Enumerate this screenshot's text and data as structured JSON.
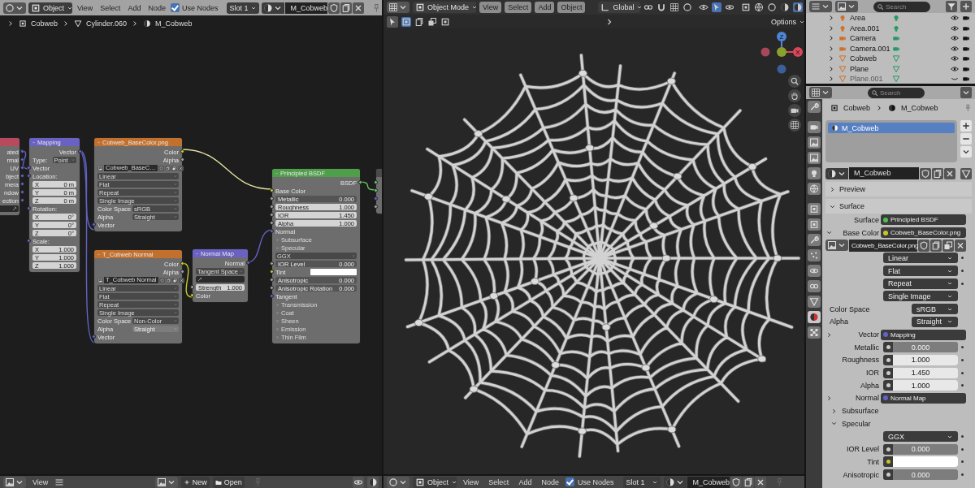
{
  "node_editor": {
    "header": {
      "mode": "Object",
      "menus": [
        "View",
        "Select",
        "Add",
        "Node"
      ],
      "use_nodes": {
        "label": "Use Nodes",
        "checked": true
      },
      "slot": "Slot 1",
      "material": "M_Cobweb"
    },
    "breadcrumbs": [
      "Cobweb",
      "Cylinder.060",
      "M_Cobweb"
    ],
    "nodes": [
      {
        "color": "#b84a5e",
        "rows": [
          {
            "kind": "output",
            "label": "ated",
            "socket": {
              "color": "#6363c7"
            }
          },
          {
            "kind": "output",
            "label": "rmal",
            "socket": {
              "color": "#6363c7"
            }
          },
          {
            "kind": "output",
            "label": "UV",
            "socket": {
              "color": "#6363c7"
            }
          },
          {
            "kind": "output",
            "label": "bject",
            "socket": {
              "color": "#6363c7"
            }
          },
          {
            "kind": "output",
            "label": "mera",
            "socket": {
              "color": "#6363c7"
            }
          },
          {
            "kind": "output",
            "label": "ndow",
            "socket": {
              "color": "#6363c7"
            }
          },
          {
            "kind": "output",
            "label": "ection",
            "socket": {
              "color": "#6363c7"
            }
          },
          {
            "kind": "uvmap"
          }
        ]
      },
      {
        "title": "Mapping",
        "color": "#6a62c2",
        "rows": [
          {
            "kind": "output",
            "label": "Vector",
            "socket": {
              "color": "#6363c7"
            }
          },
          {
            "kind": "dropdown",
            "label": "Type:",
            "value": "Point"
          },
          {
            "kind": "input",
            "label": "Vector",
            "socket": {
              "color": "#6363c7"
            }
          },
          {
            "kind": "input",
            "label": "Location:",
            "socket": {
              "color": "#6363c7"
            }
          },
          {
            "kind": "number",
            "label": "X",
            "value": "0 m"
          },
          {
            "kind": "number",
            "label": "Y",
            "value": "0 m"
          },
          {
            "kind": "number",
            "label": "Z",
            "value": "0 m"
          },
          {
            "kind": "input",
            "label": "Rotation:",
            "socket": {
              "color": "#6363c7"
            }
          },
          {
            "kind": "number",
            "label": "X",
            "value": "0°"
          },
          {
            "kind": "number",
            "label": "Y",
            "value": "0°"
          },
          {
            "kind": "number",
            "label": "Z",
            "value": "0°"
          },
          {
            "kind": "input",
            "label": "Scale:",
            "socket": {
              "color": "#6363c7"
            }
          },
          {
            "kind": "number",
            "label": "X",
            "value": "1.000"
          },
          {
            "kind": "number",
            "label": "Y",
            "value": "1.000"
          },
          {
            "kind": "number",
            "label": "Z",
            "value": "1.000"
          }
        ]
      },
      {
        "title": "Cobweb_BaseColor.png",
        "color": "#c2702e",
        "rows": [
          {
            "kind": "output",
            "label": "Color",
            "socket": {
              "color": "#c7c729"
            }
          },
          {
            "kind": "output",
            "label": "Alpha",
            "socket": {
              "color": "#a1a1a1"
            }
          },
          {
            "kind": "image",
            "value": "Cobweb_BaseC…"
          },
          {
            "kind": "dropdown",
            "value": "Linear"
          },
          {
            "kind": "dropdown",
            "value": "Flat"
          },
          {
            "kind": "dropdown",
            "value": "Repeat"
          },
          {
            "kind": "dropdown",
            "value": "Single Image"
          },
          {
            "kind": "dropdown",
            "label": "Color Space",
            "value": "sRGB"
          },
          {
            "kind": "dropdown",
            "label": "Alpha",
            "value": "Straight"
          },
          {
            "kind": "input",
            "label": "Vector",
            "socket": {
              "color": "#6363c7"
            }
          }
        ]
      },
      {
        "title": "T_Cobweb Normal",
        "color": "#c2702e",
        "rows": [
          {
            "kind": "output",
            "label": "Color",
            "socket": {
              "color": "#c7c729"
            }
          },
          {
            "kind": "output",
            "label": "Alpha",
            "socket": {
              "color": "#a1a1a1"
            }
          },
          {
            "kind": "image",
            "value": "T_Cobweb Normal"
          },
          {
            "kind": "dropdown",
            "value": "Linear"
          },
          {
            "kind": "dropdown",
            "value": "Flat"
          },
          {
            "kind": "dropdown",
            "value": "Repeat"
          },
          {
            "kind": "dropdown",
            "value": "Single Image"
          },
          {
            "kind": "dropdown",
            "label": "Color Space",
            "value": "Non-Color"
          },
          {
            "kind": "dropdown",
            "label": "Alpha",
            "value": "Straight",
            "disabled": true
          },
          {
            "kind": "input",
            "label": "Vector",
            "socket": {
              "color": "#6363c7"
            }
          }
        ]
      },
      {
        "title": "Normal Map",
        "color": "#6a62c2",
        "rows": [
          {
            "kind": "output",
            "label": "Normal",
            "socket": {
              "color": "#6363c7"
            }
          },
          {
            "kind": "dropdown",
            "value": "Tangent Space"
          },
          {
            "kind": "uvmap"
          },
          {
            "kind": "number",
            "label": "Strength",
            "value": "1.000",
            "socket": {
              "color": "#a1a1a1"
            }
          },
          {
            "kind": "input",
            "label": "Color",
            "socket": {
              "color": "#c7c729"
            }
          }
        ]
      },
      {
        "title": "Principled BSDF",
        "color": "#4e9e4a",
        "rows": [
          {
            "kind": "output",
            "label": "BSDF",
            "socket": {
              "color": "#63c763"
            }
          },
          {
            "kind": "input",
            "label": "Base Color",
            "socket": {
              "color": "#c7c729"
            }
          },
          {
            "kind": "slider",
            "label": "Metallic",
            "value": "0.000",
            "level": 0,
            "socket": {
              "color": "#a1a1a1"
            }
          },
          {
            "kind": "slider",
            "label": "Roughness",
            "value": "1.000",
            "level": 1,
            "socket": {
              "color": "#a1a1a1"
            }
          },
          {
            "kind": "number",
            "label": "IOR",
            "value": "1.450",
            "socket": {
              "color": "#a1a1a1"
            }
          },
          {
            "kind": "slider",
            "label": "Alpha",
            "value": "1.000",
            "level": 1,
            "socket": {
              "color": "#a1a1a1"
            }
          },
          {
            "kind": "input",
            "label": "Normal",
            "socket": {
              "color": "#6363c7"
            }
          },
          {
            "kind": "panel",
            "label": "Subsurface",
            "expanded": false
          },
          {
            "kind": "panel",
            "label": "Specular",
            "expanded": true
          },
          {
            "kind": "dropdown",
            "value": "GGX"
          },
          {
            "kind": "slider",
            "label": "IOR Level",
            "value": "0.000",
            "level": 0,
            "socket": {
              "color": "#a1a1a1"
            }
          },
          {
            "kind": "color",
            "label": "Tint",
            "color": "#ffffff",
            "socket": {
              "color": "#c7c729"
            }
          },
          {
            "kind": "slider",
            "label": "Anisotropic",
            "value": "0.000",
            "level": 0,
            "socket": {
              "color": "#a1a1a1"
            }
          },
          {
            "kind": "slider",
            "label": "Anisotropic Rotation",
            "value": "0.000",
            "level": 0,
            "socket": {
              "color": "#a1a1a1"
            }
          },
          {
            "kind": "input",
            "label": "Tangent",
            "socket": {
              "color": "#6363c7"
            }
          },
          {
            "kind": "panel",
            "label": "Transmission",
            "expanded": false
          },
          {
            "kind": "panel",
            "label": "Coat",
            "expanded": false
          },
          {
            "kind": "panel",
            "label": "Sheen",
            "expanded": false
          },
          {
            "kind": "panel",
            "label": "Emission",
            "expanded": false
          },
          {
            "kind": "panel",
            "label": "Thin Film",
            "expanded": false
          }
        ]
      },
      {
        "color": "#4a4a4a",
        "rows": [
          {
            "kind": "input",
            "socket": {
              "color": "#63c763"
            }
          },
          {
            "kind": "input",
            "socket": {
              "color": "#63c763"
            }
          },
          {
            "kind": "input",
            "socket": {
              "color": "#6363c7"
            }
          },
          {
            "kind": "input",
            "socket": {
              "color": "#a1a1a1"
            }
          }
        ]
      }
    ],
    "footer": {
      "view": "View",
      "new": "New",
      "open": "Open"
    }
  },
  "viewport": {
    "header": {
      "mode": "Object Mode",
      "menus": [
        "View",
        "Select",
        "Add",
        "Object"
      ],
      "orientation": "Global",
      "options": "Options"
    },
    "gizmo": {
      "z": "Z",
      "x": "X"
    }
  },
  "viewport_footer": {
    "mode": "Object",
    "menus": [
      "View",
      "Select",
      "Add",
      "Node"
    ],
    "use_nodes": {
      "label": "Use Nodes",
      "checked": true
    },
    "slot": "Slot 1",
    "material": "M_Cobweb"
  },
  "outliner": {
    "search": {
      "placeholder": "Search"
    },
    "items": [
      {
        "name": "Area",
        "kind": "light",
        "visible": true
      },
      {
        "name": "Area.001",
        "kind": "light",
        "visible": true
      },
      {
        "name": "Camera",
        "kind": "camera",
        "visible": true
      },
      {
        "name": "Camera.001",
        "kind": "camera",
        "visible": true
      },
      {
        "name": "Cobweb",
        "kind": "mesh",
        "visible": true
      },
      {
        "name": "Plane",
        "kind": "mesh",
        "visible": true
      },
      {
        "name": "Plane.001",
        "kind": "mesh",
        "visible": false
      }
    ]
  },
  "properties": {
    "search": {
      "placeholder": "Search"
    },
    "tabs": [
      {
        "selected": false
      },
      {
        "selected": false
      },
      {
        "selected": false
      },
      {
        "selected": false
      },
      {
        "selected": false
      },
      {
        "selected": false
      },
      {
        "selected": false
      },
      {
        "selected": false
      },
      {
        "selected": false
      },
      {
        "selected": false
      },
      {
        "selected": false
      },
      {
        "selected": false
      },
      {
        "selected": false
      },
      {
        "selected": true
      },
      {
        "selected": false
      }
    ],
    "breadcrumbs": [
      "Cobweb",
      "M_Cobweb"
    ],
    "slots": [
      {
        "name": "M_Cobweb",
        "selected": true
      }
    ],
    "material": "M_Cobweb",
    "panels": [
      {
        "title": "Preview",
        "expanded": false
      },
      {
        "title": "Surface",
        "expanded": true,
        "rows": [
          {
            "kind": "link",
            "label": "Surface",
            "value": "Principled BSDF",
            "color": "#4fc04f"
          },
          {
            "kind": "link",
            "label": "Base Color",
            "value": "Cobweb_BaseColor.png",
            "color": "#c7c729",
            "expanded": true
          },
          {
            "kind": "image",
            "value": "Cobweb_BaseColor.png"
          },
          {
            "kind": "dropdown",
            "value": "Linear",
            "decorator": true
          },
          {
            "kind": "dropdown",
            "value": "Flat",
            "decorator": true
          },
          {
            "kind": "dropdown",
            "value": "Repeat",
            "decorator": true
          },
          {
            "kind": "dropdown",
            "value": "Single Image"
          },
          {
            "kind": "dropdown",
            "label": "Color Space",
            "value": "sRGB"
          },
          {
            "kind": "dropdown",
            "label": "Alpha",
            "value": "Straight"
          },
          {
            "kind": "link",
            "label": "Vector",
            "value": "Mapping",
            "color": "#6363c7",
            "expanded": false
          },
          {
            "kind": "slider",
            "label": "Metallic",
            "value": "0.000",
            "level": 0,
            "decorator": true
          },
          {
            "kind": "slider",
            "label": "Roughness",
            "value": "1.000",
            "level": 1,
            "decorator": true
          },
          {
            "kind": "number",
            "label": "IOR",
            "value": "1.450",
            "decorator": true
          },
          {
            "kind": "slider",
            "label": "Alpha",
            "value": "1.000",
            "level": 1,
            "decorator": true
          },
          {
            "kind": "link",
            "label": "Normal",
            "value": "Normal Map",
            "color": "#6363c7",
            "expanded": false
          },
          {
            "kind": "subpanel",
            "label": "Subsurface",
            "expanded": false
          },
          {
            "kind": "subpanel",
            "label": "Specular",
            "expanded": true
          },
          {
            "kind": "dropdown",
            "value": "GGX",
            "decorator": true
          },
          {
            "kind": "slider",
            "label": "IOR Level",
            "value": "0.000",
            "level": 0,
            "decorator": true
          },
          {
            "kind": "color",
            "label": "Tint",
            "color": "#ffffff",
            "decorator": true
          },
          {
            "kind": "slider",
            "label": "Anisotropic",
            "value": "0.000",
            "level": 0,
            "decorator": true
          }
        ]
      }
    ]
  }
}
